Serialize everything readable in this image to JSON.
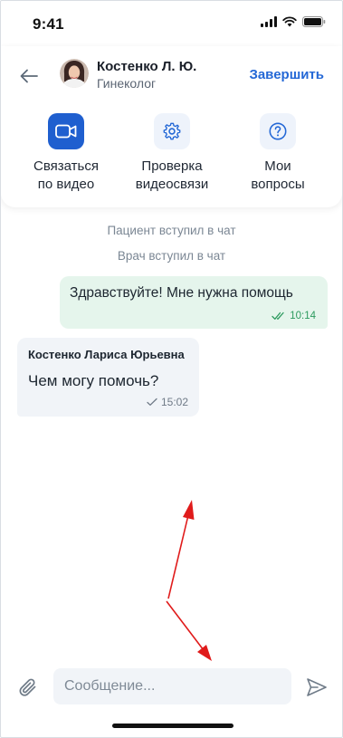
{
  "status_bar": {
    "time": "9:41"
  },
  "header": {
    "doctor_name": "Костенко Л. Ю.",
    "doctor_specialty": "Гинеколог",
    "finish_label": "Завершить"
  },
  "actions": [
    {
      "label": "Связаться\nпо видео",
      "icon": "video-camera-icon"
    },
    {
      "label": "Проверка\nвидеосвязи",
      "icon": "gear-icon"
    },
    {
      "label": "Мои\nвопросы",
      "icon": "question-icon"
    }
  ],
  "chat": {
    "system_messages": [
      "Пациент вступил в чат",
      "Врач вступил в чат"
    ],
    "outgoing": {
      "text": "Здравствуйте! Мне нужна помощь",
      "time": "10:14"
    },
    "incoming": {
      "sender": "Костенко Лариса Юрьевна",
      "text": "Чем могу помочь?",
      "time": "15:02"
    }
  },
  "composer": {
    "placeholder": "Сообщение..."
  },
  "colors": {
    "accent": "#1f5fcf",
    "link": "#2468d6",
    "outgoing_bubble": "#e5f5ec",
    "incoming_bubble": "#f1f4f8",
    "annotation_arrow": "#e01b1b"
  }
}
